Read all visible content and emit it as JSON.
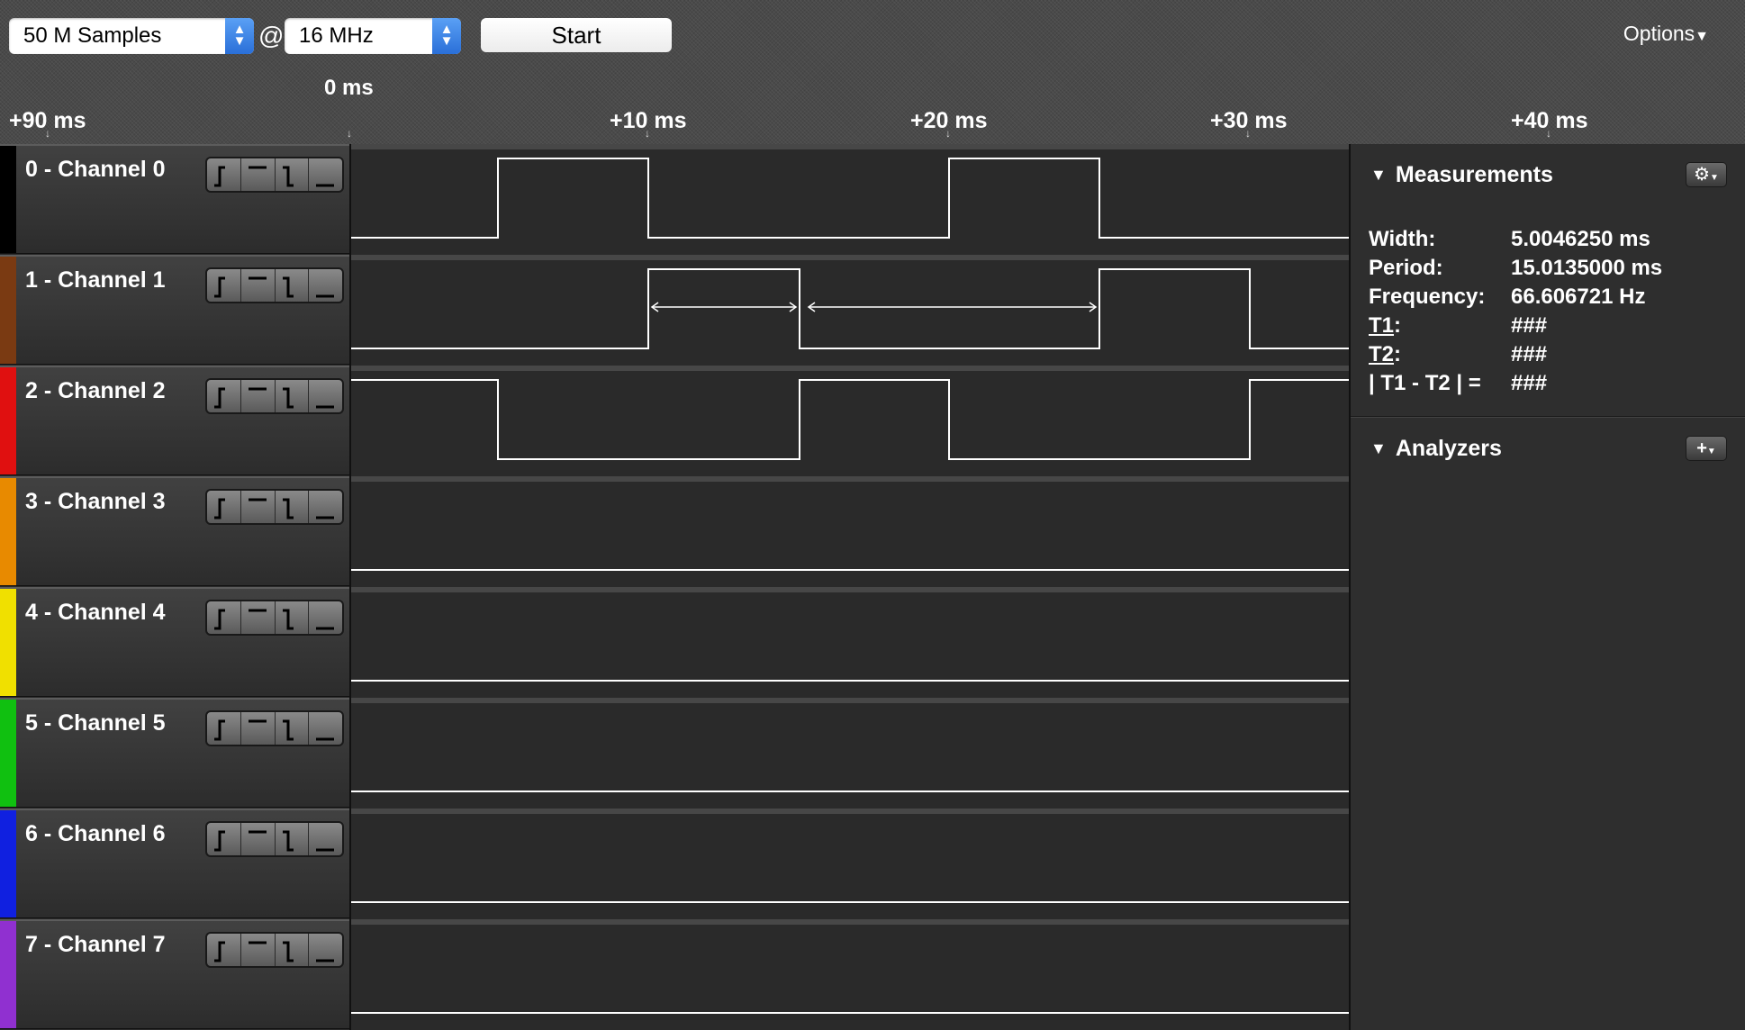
{
  "toolbar": {
    "samples": "50 M Samples",
    "at": "@",
    "rate": "16 MHz",
    "start": "Start",
    "options": "Options"
  },
  "timeline": {
    "zero_label": "0 ms",
    "ticks": [
      "+90 ms",
      "+10 ms",
      "+20 ms",
      "+30 ms",
      "+40 ms"
    ]
  },
  "channels": [
    {
      "name": "0 - Channel 0",
      "color": "#000000"
    },
    {
      "name": "1 - Channel 1",
      "color": "#7a3a12"
    },
    {
      "name": "2 - Channel 2",
      "color": "#e01010"
    },
    {
      "name": "3 - Channel 3",
      "color": "#e88a00"
    },
    {
      "name": "4 - Channel 4",
      "color": "#f0e000"
    },
    {
      "name": "5 - Channel 5",
      "color": "#10c010"
    },
    {
      "name": "6 - Channel 6",
      "color": "#1020e0"
    },
    {
      "name": "7 - Channel 7",
      "color": "#9030d0"
    }
  ],
  "measurements": {
    "title": "Measurements",
    "rows": [
      {
        "label": "Width:",
        "value": "5.0046250 ms"
      },
      {
        "label": "Period:",
        "value": "15.0135000 ms"
      },
      {
        "label": "Frequency:",
        "value": "66.606721 Hz"
      },
      {
        "label": "T1",
        "value": "###"
      },
      {
        "label": "T2",
        "value": "###"
      },
      {
        "label": "| T1 - T2 | =",
        "value": "###"
      }
    ]
  },
  "analyzers": {
    "title": "Analyzers",
    "add_button": "+"
  },
  "colors": {
    "background": "#2a2a2a",
    "waveform": "#ffffff",
    "select_accent": "#2a6fd8"
  }
}
